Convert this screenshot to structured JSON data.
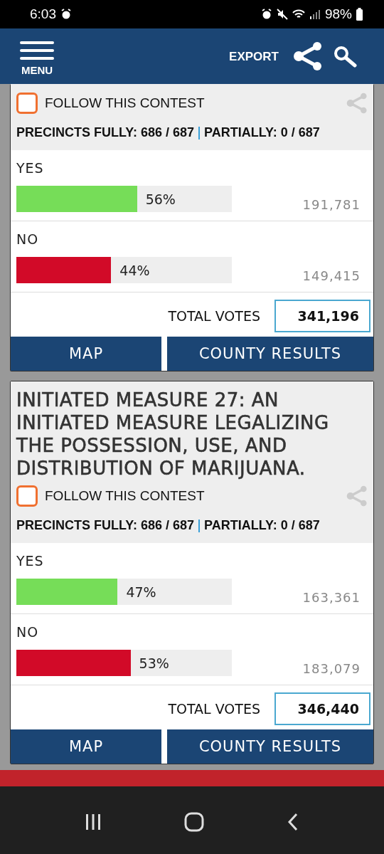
{
  "status_bar": {
    "time": "6:03",
    "battery": "98%"
  },
  "header": {
    "menu": "MENU",
    "export": "EXPORT"
  },
  "contests": [
    {
      "follow": {
        "label": "FOLLOW THIS CONTEST",
        "checked": false
      },
      "precincts_fully": "PRECINCTS FULLY: 686 / 687",
      "precincts_partially": "PARTIALLY: 0 / 687",
      "options": [
        {
          "name": "YES",
          "level": 0.56,
          "percent": "56%",
          "votes": "191,781",
          "color": "#76dd58"
        },
        {
          "name": "NO",
          "level": 0.44,
          "percent": "44%",
          "votes": "149,415",
          "color": "#d20a28"
        }
      ],
      "total_label": "TOTAL VOTES",
      "total": "341,196",
      "buttons": [
        "MAP",
        "COUNTY RESULTS"
      ]
    },
    {
      "title": "INITIATED MEASURE 27: AN INITIATED MEASURE LEGALIZING THE POSSESSION, USE, AND DISTRIBUTION OF MARIJUANA.",
      "follow": {
        "label": "FOLLOW THIS CONTEST",
        "checked": false
      },
      "precincts_fully": "PRECINCTS FULLY: 686 / 687",
      "precincts_partially": "PARTIALLY: 0 / 687",
      "options": [
        {
          "name": "YES",
          "level": 0.47,
          "percent": "47%",
          "votes": "163,361",
          "color": "#76dd58"
        },
        {
          "name": "NO",
          "level": 0.53,
          "percent": "53%",
          "votes": "183,079",
          "color": "#d20a28"
        }
      ],
      "total_label": "TOTAL VOTES",
      "total": "346,440",
      "buttons": [
        "MAP",
        "COUNTY RESULTS"
      ]
    }
  ]
}
